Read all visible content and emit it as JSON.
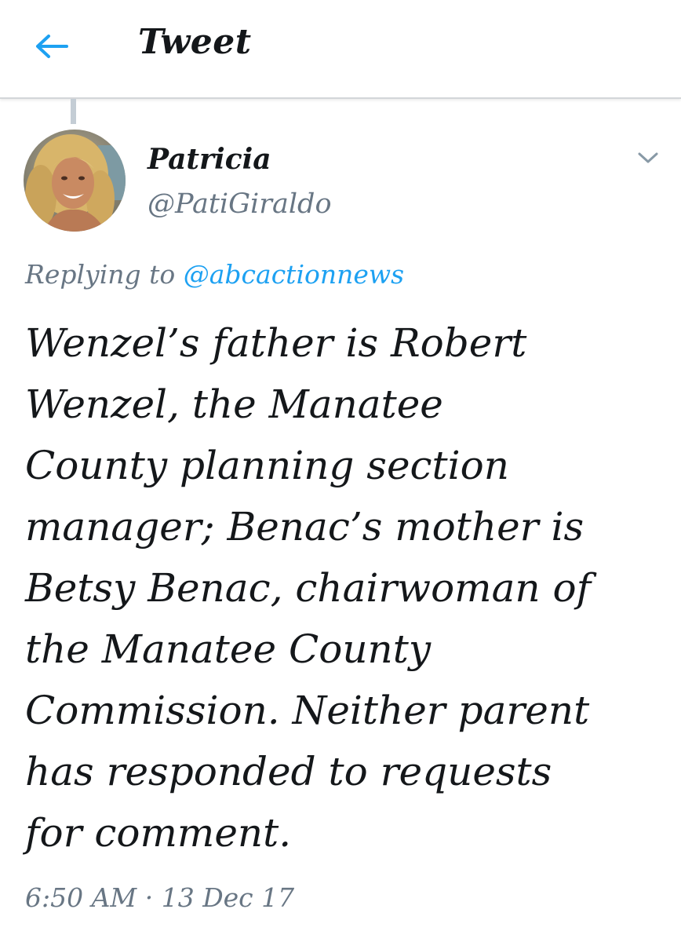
{
  "header": {
    "title": "Tweet",
    "back_icon": "arrow-left-icon"
  },
  "tweet": {
    "author": {
      "display_name": "Patricia",
      "handle": "@PatiGiraldo"
    },
    "menu_icon": "chevron-down-icon",
    "replying_to_label": "Replying to",
    "replying_to_handle": "@abcactionnews",
    "text_lines": [
      "Wenzel’s father is Robert",
      "Wenzel, the Manatee",
      "County planning section",
      "manager; Benac’s mother is",
      "Betsy Benac, chairwoman of",
      "the Manatee County",
      "Commission. Neither parent",
      "has responded to requests",
      "for comment."
    ],
    "time": "6:50 AM",
    "separator": "·",
    "date": "13 Dec 17"
  },
  "colors": {
    "accent": "#1da1f2",
    "secondary_text": "#687684",
    "primary_text": "#14171a",
    "divider": "#d3d6d9",
    "thread_line": "#c4cdd5"
  }
}
